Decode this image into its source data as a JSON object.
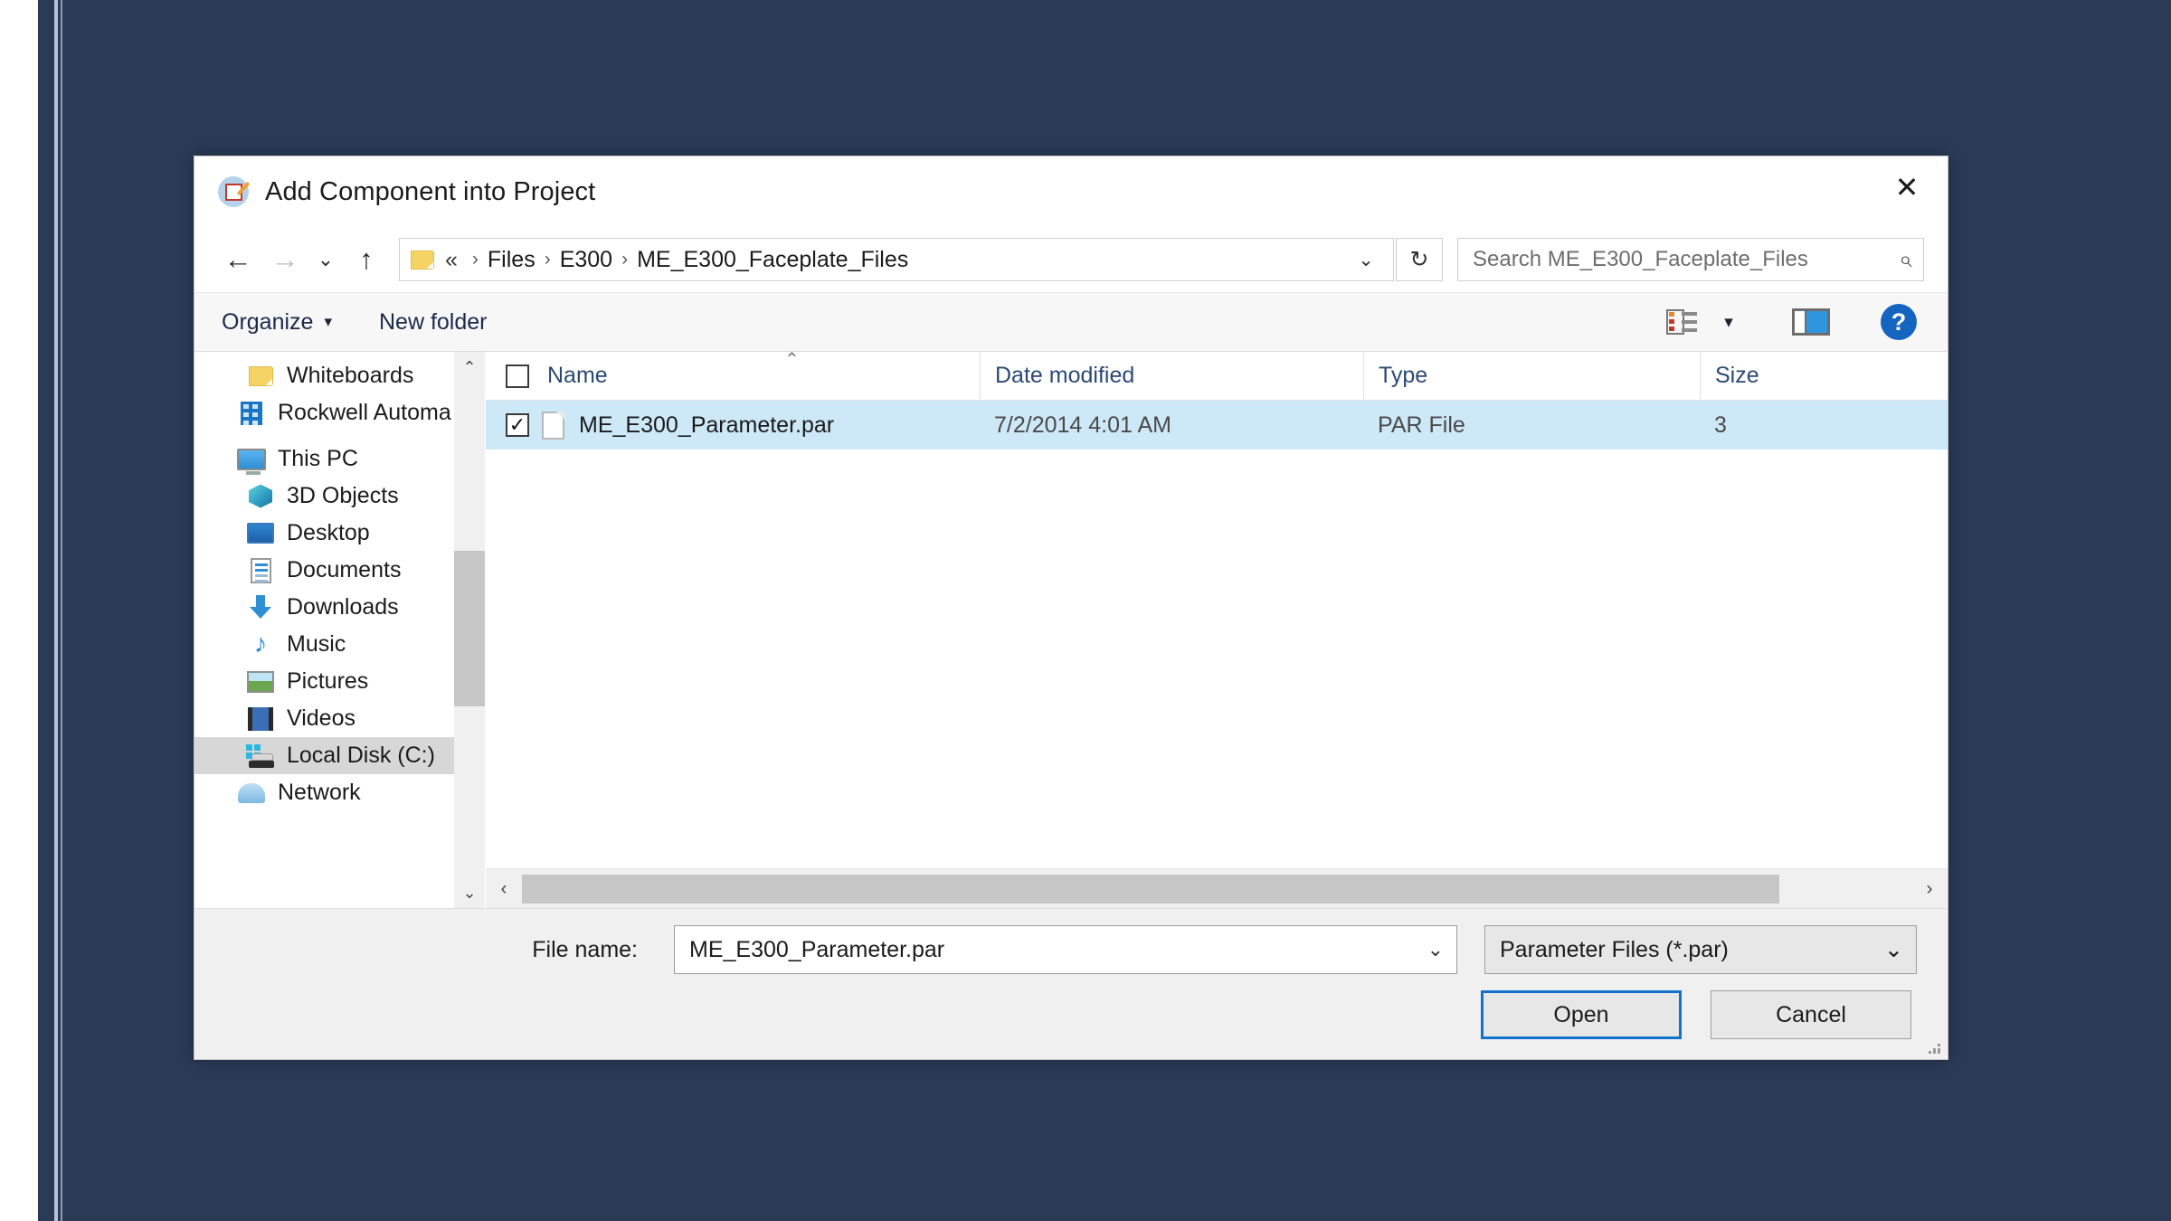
{
  "desktop": {
    "background_color": "#2b3b56"
  },
  "dialog": {
    "title": "Add Component into Project",
    "title_icon": "edit-document-icon",
    "close_label": "✕"
  },
  "address_bar": {
    "back_icon": "←",
    "forward_icon": "→",
    "recent_icon": "⌄",
    "up_icon": "↑",
    "folder_icon": "folder-icon",
    "breadcrumb_prefix": "«",
    "breadcrumbs": [
      "Files",
      "E300",
      "ME_E300_Faceplate_Files"
    ],
    "separator": "›",
    "dropdown_icon": "⌄",
    "refresh_icon": "↻",
    "search_placeholder": "Search ME_E300_Faceplate_Files",
    "search_value": "",
    "search_icon": "⌕"
  },
  "command_bar": {
    "organize_label": "Organize",
    "organize_caret": "▾",
    "new_folder_label": "New folder",
    "view_icon": "view-list-icon",
    "view_caret": "▾",
    "preview_pane_icon": "preview-pane-icon",
    "help_label": "?"
  },
  "sidebar": {
    "items": [
      {
        "label": "Whiteboards",
        "icon": "folder-icon",
        "level": 1,
        "selected": false
      },
      {
        "label": "Rockwell Automa",
        "icon": "building-icon",
        "level": 0,
        "selected": false
      },
      {
        "label": "This PC",
        "icon": "computer-icon",
        "level": 0,
        "selected": false
      },
      {
        "label": "3D Objects",
        "icon": "cube-icon",
        "level": 1,
        "selected": false
      },
      {
        "label": "Desktop",
        "icon": "desktop-icon",
        "level": 1,
        "selected": false
      },
      {
        "label": "Documents",
        "icon": "documents-icon",
        "level": 1,
        "selected": false
      },
      {
        "label": "Downloads",
        "icon": "download-icon",
        "level": 1,
        "selected": false
      },
      {
        "label": "Music",
        "icon": "music-note-icon",
        "level": 1,
        "selected": false
      },
      {
        "label": "Pictures",
        "icon": "pictures-icon",
        "level": 1,
        "selected": false
      },
      {
        "label": "Videos",
        "icon": "videos-icon",
        "level": 1,
        "selected": false
      },
      {
        "label": "Local Disk (C:)",
        "icon": "hard-disk-icon",
        "level": 1,
        "selected": true
      },
      {
        "label": "Network",
        "icon": "network-icon",
        "level": 0,
        "selected": false
      }
    ],
    "scroll_up_icon": "⌃",
    "scroll_down_icon": "⌄"
  },
  "file_list": {
    "columns": [
      "Name",
      "Date modified",
      "Type",
      "Size"
    ],
    "sort_indicator": "⌃",
    "select_all_checked": false,
    "rows": [
      {
        "checked": true,
        "check_mark": "✓",
        "icon": "file-icon",
        "name": "ME_E300_Parameter.par",
        "date_modified": "7/2/2014 4:01 AM",
        "type": "PAR File",
        "size": "3",
        "selected": true
      }
    ],
    "h_scroll_left_icon": "‹",
    "h_scroll_right_icon": "›"
  },
  "footer": {
    "file_name_label": "File name:",
    "file_name_value": "ME_E300_Parameter.par",
    "file_name_chevron": "⌄",
    "filter_value": "Parameter Files (*.par)",
    "filter_chevron": "⌄",
    "open_label": "Open",
    "cancel_label": "Cancel"
  }
}
